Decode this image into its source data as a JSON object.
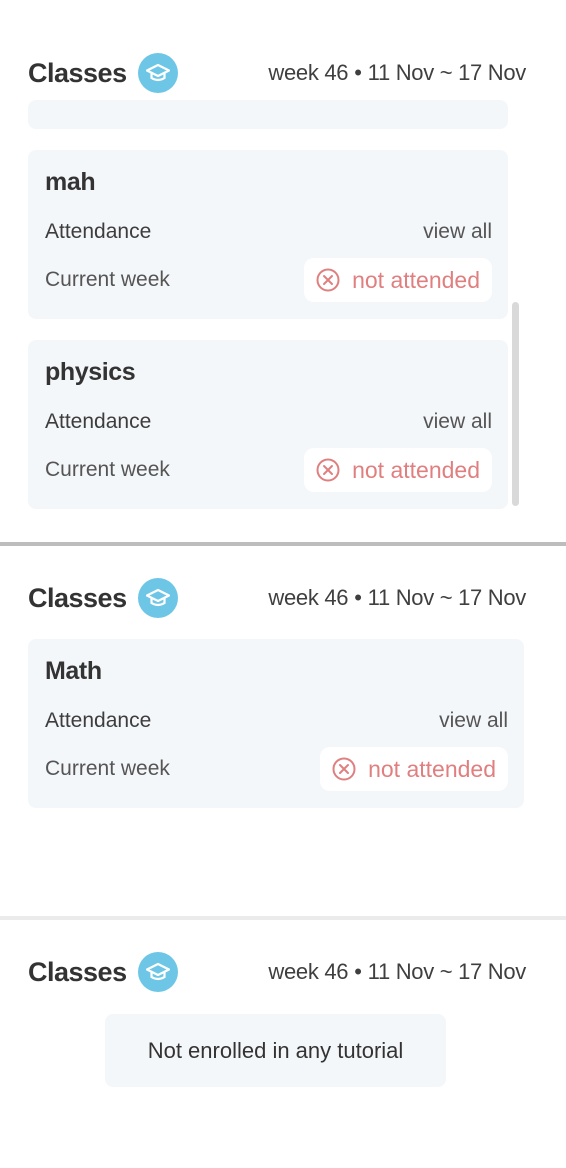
{
  "panels": [
    {
      "title": "Classes",
      "week": {
        "label": "week 46",
        "separator": "•",
        "range": "11 Nov ~ 17 Nov"
      },
      "classes": [
        {
          "name": "mah",
          "attendance_label": "Attendance",
          "view_all": "view all",
          "current_week_label": "Current week",
          "status": "not attended"
        },
        {
          "name": "physics",
          "attendance_label": "Attendance",
          "view_all": "view all",
          "current_week_label": "Current week",
          "status": "not attended"
        }
      ]
    },
    {
      "title": "Classes",
      "week": {
        "label": "week 46",
        "separator": "•",
        "range": "11 Nov ~ 17 Nov"
      },
      "classes": [
        {
          "name": "Math",
          "attendance_label": "Attendance",
          "view_all": "view all",
          "current_week_label": "Current week",
          "status": "not attended"
        }
      ]
    },
    {
      "title": "Classes",
      "week": {
        "label": "week 46",
        "separator": "•",
        "range": "11 Nov ~ 17 Nov"
      },
      "empty_message": "Not enrolled in any tutorial"
    }
  ],
  "icons": {
    "title_icon": "graduation-cap-icon",
    "status_icon": "circle-x-icon"
  },
  "colors": {
    "accent": "#6ec6e6",
    "not_attended": "#e07f7f",
    "card_bg": "#f4f7fa"
  }
}
